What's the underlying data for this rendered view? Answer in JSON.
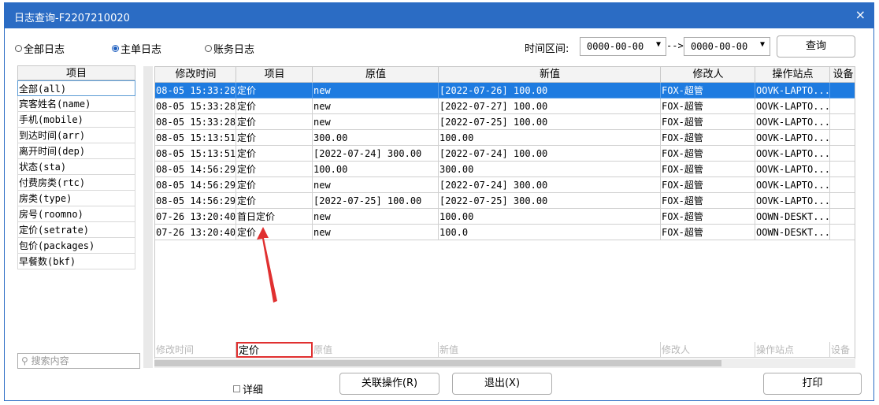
{
  "window": {
    "title": "日志查询-F2207210020",
    "close_symbol": "×"
  },
  "filters": {
    "radios": [
      {
        "label": "全部日志",
        "selected": false
      },
      {
        "label": "主单日志",
        "selected": true
      },
      {
        "label": "账务日志",
        "selected": false
      }
    ],
    "time_label": "时间区间:",
    "date_from": "0000-00-00",
    "date_to": "0000-00-00",
    "arrow": "-->",
    "query_button": "查询"
  },
  "left_panel": {
    "header": "项目",
    "items": [
      "全部(all)",
      "宾客姓名(name)",
      "手机(mobile)",
      "到达时间(arr)",
      "离开时间(dep)",
      "状态(sta)",
      "付费房类(rtc)",
      "房类(type)",
      "房号(roomno)",
      "定价(setrate)",
      "包价(packages)",
      "早餐数(bkf)"
    ],
    "selected_index": 0,
    "search_placeholder": "搜索内容"
  },
  "grid": {
    "headers": [
      "修改时间",
      "项目",
      "原值",
      "新值",
      "修改人",
      "操作站点",
      "设备"
    ],
    "rows": [
      [
        "08-05 15:33:28",
        "定价",
        "new",
        "[2022-07-26] 100.00",
        "FOX-超管",
        "OOVK-LAPTO...",
        ""
      ],
      [
        "08-05 15:33:28",
        "定价",
        "new",
        "[2022-07-27] 100.00",
        "FOX-超管",
        "OOVK-LAPTO...",
        ""
      ],
      [
        "08-05 15:33:28",
        "定价",
        "new",
        "[2022-07-25] 100.00",
        "FOX-超管",
        "OOVK-LAPTO...",
        ""
      ],
      [
        "08-05 15:13:51",
        "定价",
        "300.00",
        "100.00",
        "FOX-超管",
        "OOVK-LAPTO...",
        ""
      ],
      [
        "08-05 15:13:51",
        "定价",
        "[2022-07-24] 300.00",
        "[2022-07-24] 100.00",
        "FOX-超管",
        "OOVK-LAPTO...",
        ""
      ],
      [
        "08-05 14:56:29",
        "定价",
        "100.00",
        "300.00",
        "FOX-超管",
        "OOVK-LAPTO...",
        ""
      ],
      [
        "08-05 14:56:29",
        "定价",
        "new",
        "[2022-07-24] 300.00",
        "FOX-超管",
        "OOVK-LAPTO...",
        ""
      ],
      [
        "08-05 14:56:29",
        "定价",
        "[2022-07-25] 100.00",
        "[2022-07-25] 300.00",
        "FOX-超管",
        "OOVK-LAPTO...",
        ""
      ],
      [
        "07-26 13:20:40",
        "首日定价",
        "new",
        "100.00",
        "FOX-超管",
        "OOWN-DESKT...",
        ""
      ],
      [
        "07-26 13:20:40",
        "定价",
        "new",
        "100.0",
        "FOX-超管",
        "OOWN-DESKT...",
        ""
      ]
    ],
    "selected_row": 0,
    "filter_row": [
      "修改时间",
      "定价",
      "原值",
      "新值",
      "修改人",
      "操作站点",
      "设备"
    ],
    "active_filter_index": 1
  },
  "footer": {
    "detail_label": "详细",
    "related_button": "关联操作(R)",
    "exit_button": "退出(X)",
    "print_button": "打印"
  },
  "colors": {
    "accent": "#2b6cc4",
    "selection": "#1e7be0",
    "highlight_box": "#e03030"
  }
}
